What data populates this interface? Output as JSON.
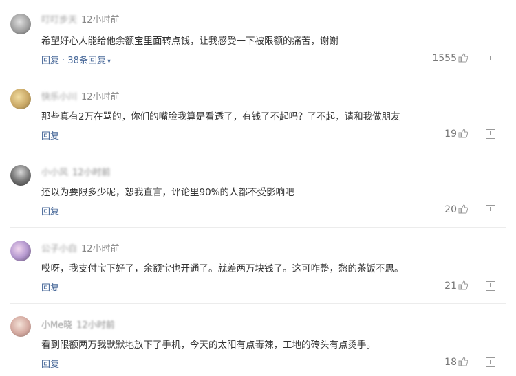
{
  "comments": [
    {
      "username": "叮叮步天",
      "time": "12小时前",
      "text": "希望好心人能给他余额宝里面转点钱，让我感受一下被限额的痛苦，谢谢",
      "reply_label": "回复 · 38条回复",
      "likes": "1555"
    },
    {
      "username": "快乐小川",
      "time": "12小时前",
      "text": "那些真有2万在骂的，你们的嘴脸我算是看透了，有钱了不起吗？了不起，请和我做朋友",
      "reply_label": "回复",
      "likes": "19"
    },
    {
      "username": "小小风",
      "time": "12小时前",
      "text": "还以为要限多少呢，恕我直言，评论里90%的人都不受影响吧",
      "reply_label": "回复",
      "likes": "20"
    },
    {
      "username": "公子小白",
      "time": "12小时前",
      "text": "哎呀，我支付宝下好了，余额宝也开通了。就差两万块钱了。这可咋整，愁的茶饭不思。",
      "reply_label": "回复",
      "likes": "21"
    },
    {
      "username": "小Me晓",
      "time": "12小时前",
      "text": "看到限额两万我默默地放下了手机，今天的太阳有点毒辣，工地的砖头有点烫手。",
      "reply_label": "回复",
      "likes": "18"
    }
  ]
}
